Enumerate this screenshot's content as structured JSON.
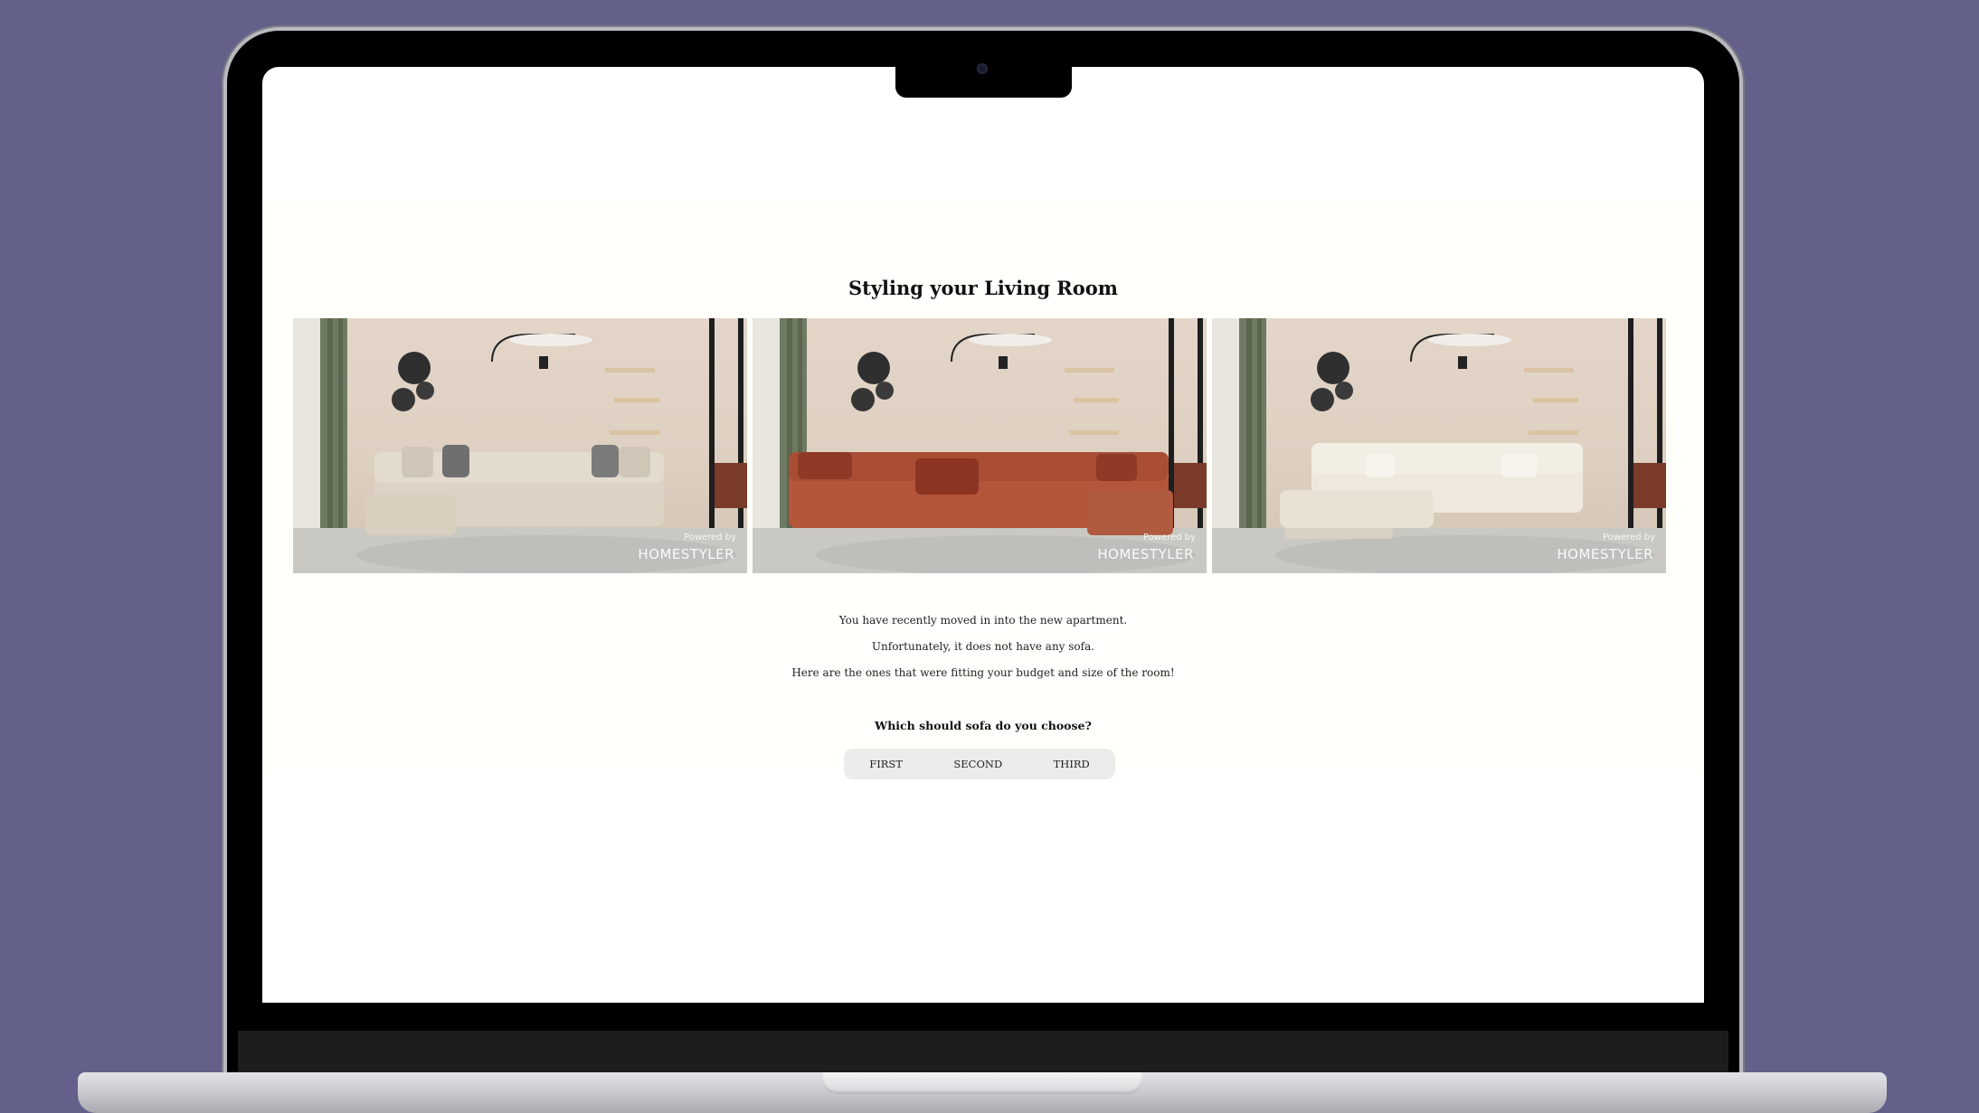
{
  "page": {
    "title": "Styling your Living Room"
  },
  "gallery": {
    "images": [
      {
        "sofa_color": "#dcd3c4",
        "powered_text": "Powered by",
        "brand": "HOMESTYLER"
      },
      {
        "sofa_color": "#b4563b",
        "powered_text": "Powered by",
        "brand": "HOMESTYLER"
      },
      {
        "sofa_color": "#efe9dd",
        "powered_text": "Powered by",
        "brand": "HOMESTYLER"
      }
    ]
  },
  "intro": {
    "line1": "You have recently moved in into the new apartment.",
    "line2": "Unfortunately, it does not have any sofa.",
    "line3": "Here are the ones that were fitting your budget and size of the room!"
  },
  "question": {
    "text": "Which should sofa do you choose?",
    "options": [
      "FIRST",
      "SECOND",
      "THIRD"
    ]
  },
  "colors": {
    "background": "#63608a",
    "content_bg": "#fffffb",
    "choice_bg": "#ececec"
  }
}
